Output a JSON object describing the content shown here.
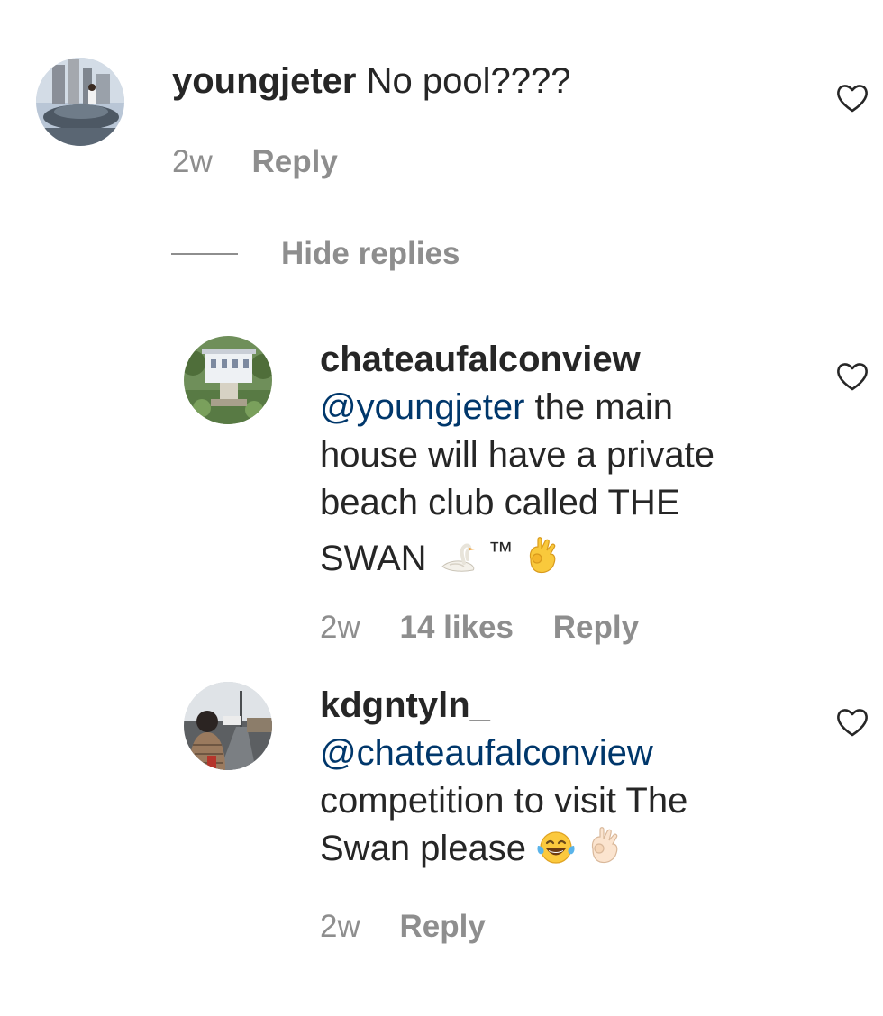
{
  "comment": {
    "username": "youngjeter",
    "text": "No pool????",
    "time": "2w",
    "reply_label": "Reply"
  },
  "hide_replies_label": "Hide replies",
  "replies": [
    {
      "username": "chateaufalconview",
      "mention": "@youngjeter",
      "text_line1": "the main",
      "text_line2": "house will have a private",
      "text_line3": "beach club called THE",
      "text_line4": "SWAN",
      "tm": "™",
      "time": "2w",
      "likes": "14 likes",
      "reply_label": "Reply"
    },
    {
      "username": "kdgntyln_",
      "mention": "@chateaufalconview",
      "text_line1": "competition to visit The",
      "text_line2": "Swan please",
      "time": "2w",
      "reply_label": "Reply"
    }
  ],
  "icons": {
    "like": "heart-outline-icon",
    "swan": "swan-emoji",
    "ok_hand": "ok-hand-emoji",
    "laughing": "tears-of-joy-emoji"
  },
  "colors": {
    "text": "#262626",
    "secondary": "#8e8e8e",
    "mention": "#00376b"
  }
}
